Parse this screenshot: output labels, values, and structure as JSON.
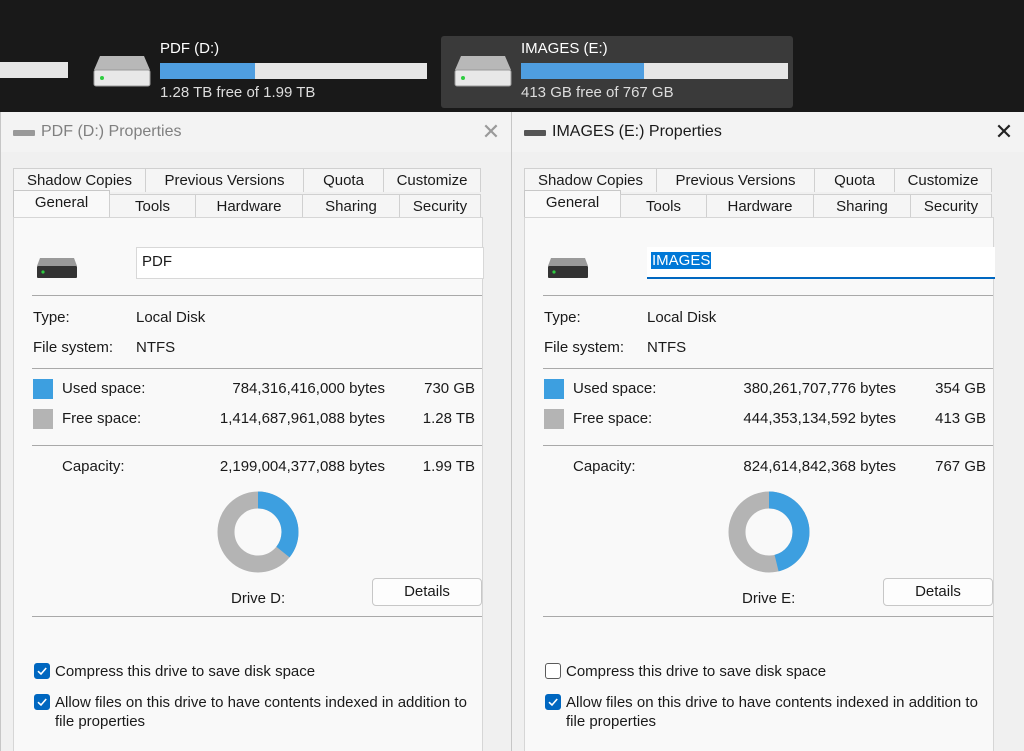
{
  "explorer": {
    "drives": [
      {
        "name": "PDF (D:)",
        "free_text": "1.28 TB free of 1.99 TB",
        "used_fraction": 0.357,
        "selected": false
      },
      {
        "name": "IMAGES (E:)",
        "free_text": "413 GB free of 767 GB",
        "used_fraction": 0.46,
        "selected": true
      }
    ]
  },
  "dialogs": [
    {
      "title": "PDF (D:) Properties",
      "active": false,
      "tabs_row1": [
        "Shadow Copies",
        "Previous Versions",
        "Quota",
        "Customize"
      ],
      "tabs_row2": [
        "General",
        "Tools",
        "Hardware",
        "Sharing",
        "Security"
      ],
      "active_tab": "General",
      "volume_name": "PDF",
      "type_label": "Type:",
      "type_value": "Local Disk",
      "fs_label": "File system:",
      "fs_value": "NTFS",
      "used_label": "Used space:",
      "used_bytes": "784,316,416,000 bytes",
      "used_size": "730 GB",
      "free_label": "Free space:",
      "free_bytes": "1,414,687,961,088 bytes",
      "free_size": "1.28 TB",
      "capacity_label": "Capacity:",
      "capacity_bytes": "2,199,004,377,088 bytes",
      "capacity_size": "1.99 TB",
      "used_fraction": 0.357,
      "drive_label": "Drive D:",
      "details_button": "Details",
      "compress_label": "Compress this drive to save disk space",
      "compress_checked": true,
      "index_label": "Allow files on this drive to have contents indexed in addition to file properties",
      "index_checked": true
    },
    {
      "title": "IMAGES (E:) Properties",
      "active": true,
      "tabs_row1": [
        "Shadow Copies",
        "Previous Versions",
        "Quota",
        "Customize"
      ],
      "tabs_row2": [
        "General",
        "Tools",
        "Hardware",
        "Sharing",
        "Security"
      ],
      "active_tab": "General",
      "volume_name": "IMAGES",
      "type_label": "Type:",
      "type_value": "Local Disk",
      "fs_label": "File system:",
      "fs_value": "NTFS",
      "used_label": "Used space:",
      "used_bytes": "380,261,707,776 bytes",
      "used_size": "354 GB",
      "free_label": "Free space:",
      "free_bytes": "444,353,134,592 bytes",
      "free_size": "413 GB",
      "capacity_label": "Capacity:",
      "capacity_bytes": "824,614,842,368 bytes",
      "capacity_size": "767 GB",
      "used_fraction": 0.461,
      "drive_label": "Drive E:",
      "details_button": "Details",
      "compress_label": "Compress this drive to save disk space",
      "compress_checked": false,
      "index_label": "Allow files on this drive to have contents indexed in addition to file properties",
      "index_checked": true
    }
  ],
  "colors": {
    "used": "#3d9fe0",
    "free": "#b4b4b4",
    "accent": "#0067c0",
    "explorer_bar_fill": "#4f9ee0"
  }
}
